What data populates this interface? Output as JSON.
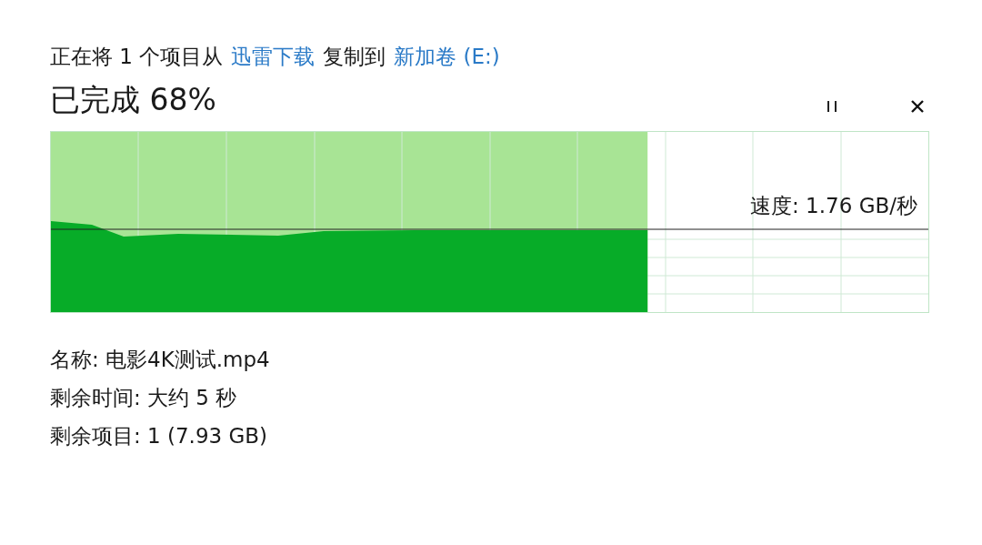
{
  "header": [
    {
      "kind": "text",
      "text": "正在将 1 个项目从"
    },
    {
      "kind": "link",
      "text": "迅雷下载"
    },
    {
      "kind": "text",
      "text": "复制到"
    },
    {
      "kind": "link",
      "text": "新加卷 (E:)"
    }
  ],
  "progress_title": "已完成 68%",
  "graph": {
    "level": 0.68,
    "speed": "速度: 1.76 GB/秒"
  },
  "details": [
    {
      "label": "名称:",
      "value": "电影4K测试.mp4"
    },
    {
      "label": "剩余时间:",
      "value": "大约 5 秒"
    },
    {
      "label": "剩余项目:",
      "value": "1 (7.93 GB)"
    }
  ]
}
